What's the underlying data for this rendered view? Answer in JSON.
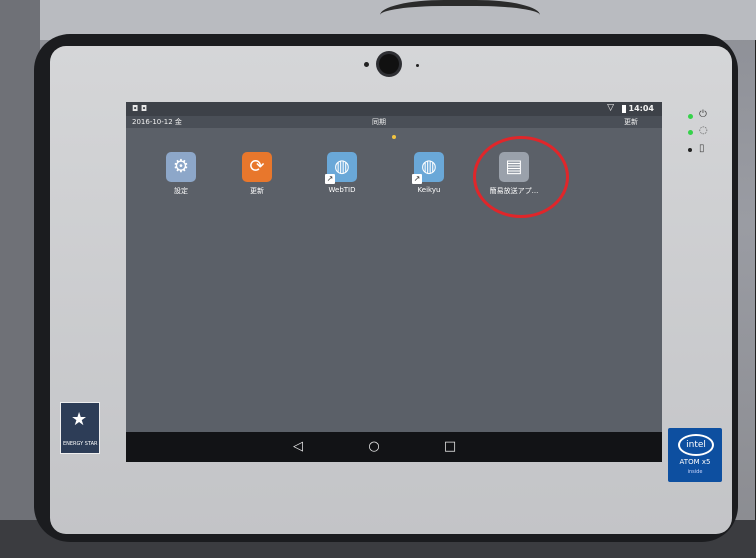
{
  "status_bar": {
    "left_icons": "◘ ◘",
    "time": "14:04",
    "wifi_icon": "wifi-icon",
    "battery_icon": "battery-icon"
  },
  "info_bar": {
    "date": "2016-10-12 金",
    "center_text": "同期",
    "right_text": "更新"
  },
  "apps": [
    {
      "label": "設定",
      "icon": "settings-gear-icon",
      "color": "#8da7c9",
      "glyph": "⚙",
      "shortcut": false
    },
    {
      "label": "更新",
      "icon": "update-icon",
      "color": "#e8772c",
      "glyph": "⟳",
      "shortcut": false
    },
    {
      "label": "WebTID",
      "icon": "browser-globe-icon",
      "color": "#6aa8d8",
      "glyph": "◍",
      "shortcut": true
    },
    {
      "label": "Keikyu",
      "icon": "browser-globe-icon",
      "color": "#6aa8d8",
      "glyph": "◍",
      "shortcut": true
    },
    {
      "label": "簡易放送アプ...",
      "icon": "broadcast-app-icon",
      "color": "#9aa1ab",
      "glyph": "▤",
      "shortcut": false
    }
  ],
  "navbar": {
    "back": "◁",
    "home": "○",
    "recents": "□"
  },
  "badges": {
    "energy_star_label": "ENERGY STAR",
    "intel_logo": "intel",
    "intel_chip": "ATOM x5",
    "intel_inside": "inside"
  },
  "highlight": {
    "target_app": "簡易放送アプ...",
    "ring_color": "#e0262a"
  }
}
